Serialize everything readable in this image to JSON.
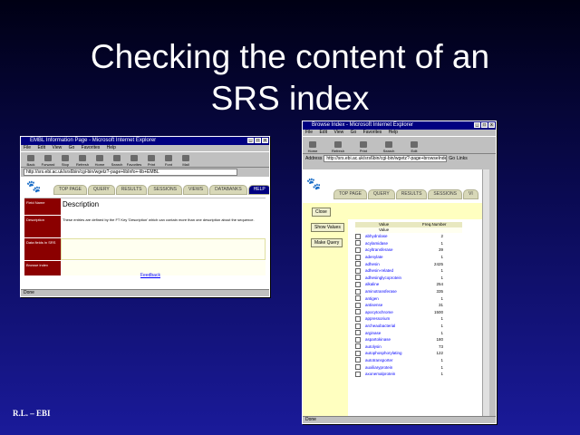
{
  "slide": {
    "title_line1": "Checking the content of an",
    "title_line2": "SRS index",
    "footer": "R.L. – EBI"
  },
  "left_window": {
    "title": "EMBL Information Page - Microsoft Internet Explorer",
    "menu": [
      "File",
      "Edit",
      "View",
      "Go",
      "Favorites",
      "Help"
    ],
    "toolbar": [
      "Back",
      "Forward",
      "Stop",
      "Refresh",
      "Home",
      "Search",
      "Favorites",
      "Print",
      "Font",
      "Mail"
    ],
    "address": "http://srs.ebi.ac.uk/srs6bin/cgi-bin/wgetz?-page+libInfo+-lib+EMBL",
    "tabs": [
      "TOP PAGE",
      "QUERY",
      "RESULTS",
      "SESSIONS",
      "VIEWS",
      "DATABANKS",
      "HELP"
    ],
    "rows": [
      {
        "label": "Field Name",
        "value": "Description"
      },
      {
        "label": "Description",
        "value": "These entries are defined by the FT Key 'Description' which can contain more than one description about the sequence."
      },
      {
        "label": "Data fields in SRS",
        "value": ""
      },
      {
        "label": "Browse index",
        "value": ""
      }
    ],
    "footer_link": "Feedback",
    "status": "Done"
  },
  "right_window": {
    "title": "Browse Index - Microsoft Internet Explorer",
    "menu": [
      "File",
      "Edit",
      "View",
      "Go",
      "Favorites",
      "Help"
    ],
    "toolbar": [
      "Home",
      "Refresh",
      "Print",
      "Search",
      "Edit"
    ],
    "address_label": "Address",
    "address": "http://srs.ebi.ac.uk/srs6bin/cgi-bin/wgetz?-page+browseIndex",
    "go_label": "Go",
    "links_label": "Links",
    "tabs": [
      "TOP PAGE",
      "QUERY",
      "RESULTS",
      "SESSIONS",
      "VI"
    ],
    "close_button": "Close",
    "show_values_button": "Show Values",
    "make_query_button": "Make Query",
    "table": {
      "col_value": "Value",
      "col_count": "Freq.Number",
      "subheader": "Value",
      "rows": [
        {
          "value": "abhydrolase",
          "count": "2"
        },
        {
          "value": "acylamidase",
          "count": "1"
        },
        {
          "value": "acyltransferase",
          "count": "39"
        },
        {
          "value": "adenylate",
          "count": "1"
        },
        {
          "value": "adhesin",
          "count": "2425"
        },
        {
          "value": "adhesin-related",
          "count": "1"
        },
        {
          "value": "adhesinglycoprotein",
          "count": "1"
        },
        {
          "value": "alkaline",
          "count": "254"
        },
        {
          "value": "aminotransferase",
          "count": "335"
        },
        {
          "value": "antigen",
          "count": "1"
        },
        {
          "value": "antisense",
          "count": "31"
        },
        {
          "value": "apocytochrome",
          "count": "1500"
        },
        {
          "value": "appressorium",
          "count": "1"
        },
        {
          "value": "archeaobacterial",
          "count": "1"
        },
        {
          "value": "arginase",
          "count": "1"
        },
        {
          "value": "aspartokinase",
          "count": "180"
        },
        {
          "value": "autolysin",
          "count": "73"
        },
        {
          "value": "autophosphorylating",
          "count": "122"
        },
        {
          "value": "autotransporter",
          "count": "1"
        },
        {
          "value": "auxiliaryprotein",
          "count": "1"
        },
        {
          "value": "axonemalprotein",
          "count": "1"
        }
      ]
    },
    "status": "Done"
  },
  "colors": {
    "bg_top": "#000014",
    "bg_bottom": "#1a1a9a",
    "titlebar": "#000080",
    "label_red": "#8b0000",
    "panel_yellow": "#ffffc0"
  }
}
